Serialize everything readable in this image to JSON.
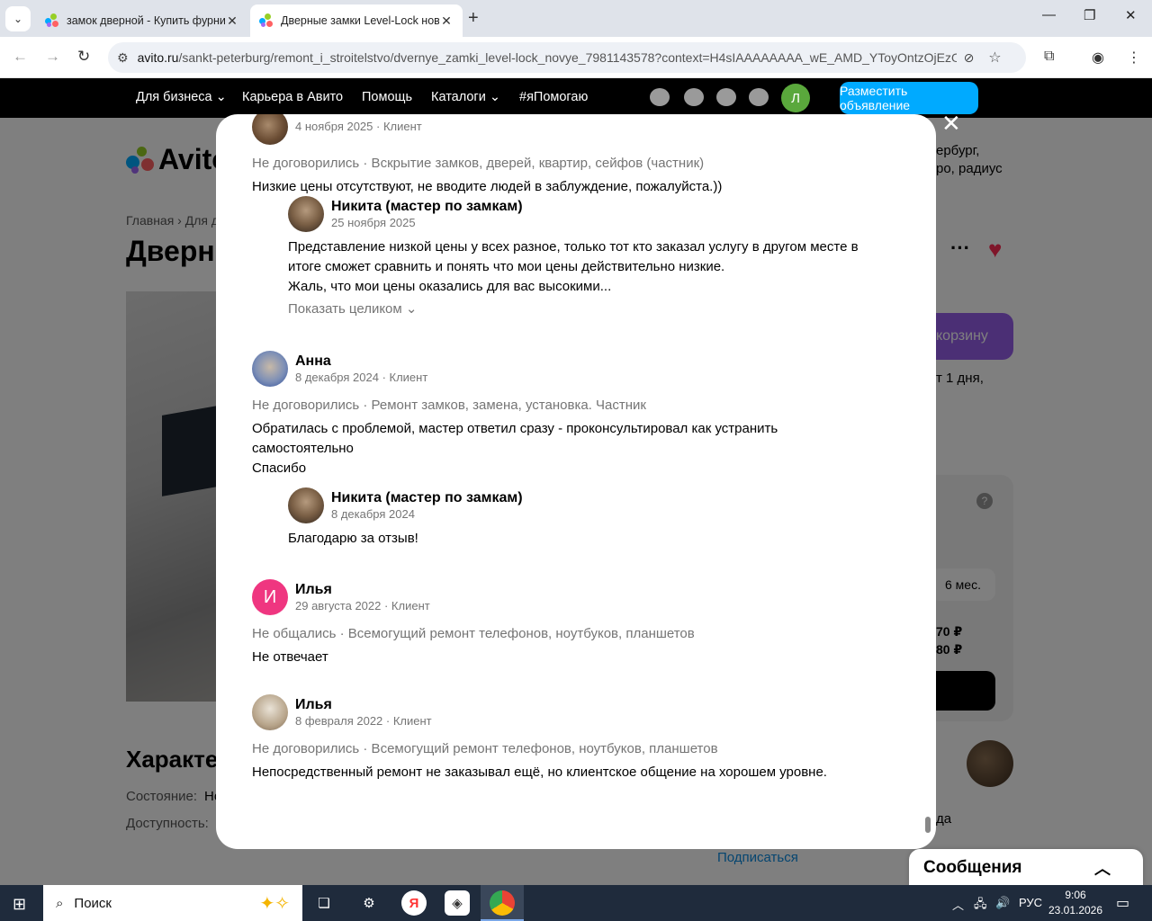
{
  "browser": {
    "tabs": [
      {
        "title": "замок дверной - Купить фурни"
      },
      {
        "title": "Дверные замки Level-Lock нов"
      }
    ],
    "url_host": "avito.ru",
    "url_path": "/sankt-peterburg/remont_i_stroitelstvo/dvernye_zamki_level-lock_novye_7981143578?context=H4sIAAAAAAAA_wE_AMD_YToyOntzOjEzOi..."
  },
  "avito_header": {
    "nav": [
      "Для бизнеса ⌄",
      "Карьера в Авито",
      "Помощь",
      "Каталоги ⌄",
      "#яПомогаю"
    ],
    "avatar_letter": "Л",
    "post_button": "Разместить объявление",
    "logo": "Avito"
  },
  "background": {
    "breadcrumb": "Главная › Для д",
    "title_fragment": "Дверн",
    "city_line1": "ербург,",
    "city_line2": "ро, радиус",
    "cart_button": "корзину",
    "delivery": "т 1 дня,",
    "char_heading": "Характе",
    "state_label": "Состояние:",
    "state_value": "Но",
    "availability_label": "Доступность:",
    "price_a": "70 ₽",
    "price_b": "80 ₽",
    "period_pill": "6 мес.",
    "subscribe": "Подписаться",
    "da": "да",
    "messages_bar": "Сообщения"
  },
  "modal": {
    "reviews": [
      {
        "name": "",
        "meta": "4 ноября 2025 · Клиент",
        "deal": "Не договорились · Вскрытие замков, дверей, квартир, сейфов (частник)",
        "text": [
          "Низкие цены отсутствуют, не вводите людей в заблуждение, пожалуйста.))"
        ],
        "reply": {
          "name": "Никита (мастер по замкам)",
          "meta": "25 ноября 2025",
          "text": [
            "Представление низкой цены у всех разное, только тот кто заказал услугу в другом месте в",
            "итоге сможет сравнить и понять что мои цены действительно низкие.",
            "Жаль, что мои цены оказались для вас высокими..."
          ],
          "show_all": "Показать целиком ⌄"
        }
      },
      {
        "name": "Анна",
        "meta": "8 декабря 2024 · Клиент",
        "deal": "Не договорились · Ремонт замков, замена, установка. Частник",
        "text": [
          "Обратилась с проблемой, мастер ответил сразу - проконсультировал как устранить",
          "самостоятельно",
          "Спасибо"
        ],
        "reply": {
          "name": "Никита (мастер по замкам)",
          "meta": "8 декабря 2024",
          "text": [
            "Благодарю за отзыв!"
          ]
        }
      },
      {
        "name": "Илья",
        "avatar_letter": "И",
        "meta": "29 августа 2022 · Клиент",
        "deal": "Не общались · Всемогущий ремонт телефонов, ноутбуков, планшетов",
        "text": [
          "Не отвечает"
        ]
      },
      {
        "name": "Илья",
        "meta": "8 февраля 2022 · Клиент",
        "deal": "Не договорились · Всемогущий ремонт телефонов, ноутбуков, планшетов",
        "text": [
          "Непосредственный ремонт не заказывал ещё, но клиентское общение на хорошем уровне."
        ]
      }
    ]
  },
  "taskbar": {
    "search_placeholder": "Поиск",
    "lang": "РУС",
    "time": "9:06",
    "date": "23.01.2026"
  },
  "colors": {
    "avito_blue": "#00aaff",
    "avito_purple": "#965eeb",
    "ilya_avatar": "#ef3680",
    "muted_text": "#757575"
  }
}
